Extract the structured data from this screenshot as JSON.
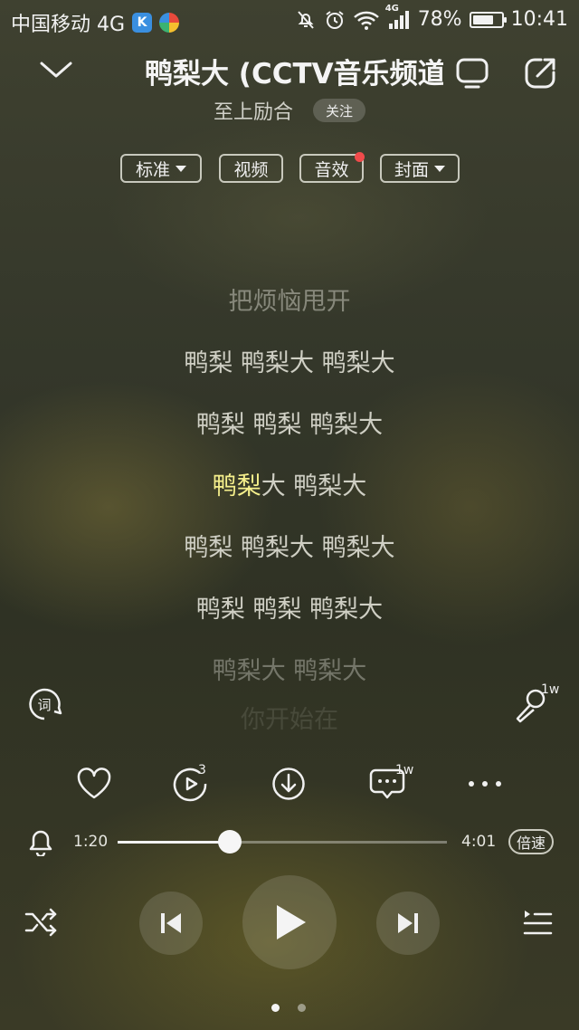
{
  "status_bar": {
    "carrier": "中国移动 4G",
    "network_badge": "4G",
    "battery": "78%",
    "battery_level": 0.78,
    "time": "10:41",
    "icons": [
      "k-app-icon",
      "round-app-icon",
      "mute-icon",
      "alarm-icon",
      "wifi-icon",
      "signal-icon",
      "battery-icon"
    ]
  },
  "header": {
    "song_title": "鸭梨大 (CCTV音乐频道",
    "artist": "至上励合",
    "follow_label": "关注",
    "icons": [
      "chevron-down-icon",
      "tv-cast-icon",
      "share-icon"
    ]
  },
  "chips": {
    "quality": "标准",
    "video": "视频",
    "effects": "音效",
    "cover": "封面"
  },
  "lyrics": {
    "line1": "把烦恼甩开",
    "line2": "鸭梨 鸭梨大 鸭梨大",
    "line3": "鸭梨 鸭梨 鸭梨大",
    "line4_sung": "鸭梨",
    "line4_rest": "大 鸭梨大",
    "line5": "鸭梨 鸭梨大 鸭梨大",
    "line6": "鸭梨 鸭梨 鸭梨大",
    "line7": "鸭梨大 鸭梨大",
    "line8": "你开始在"
  },
  "side": {
    "karaoke_count": "1w"
  },
  "actions": {
    "mv_count": "3",
    "comment_count": "1w",
    "icons": [
      "heart-icon",
      "mv-play-icon",
      "download-icon",
      "comment-icon",
      "more-icon"
    ]
  },
  "progress": {
    "elapsed": "1:20",
    "total": "4:01",
    "fraction": 0.34,
    "speed_label": "倍速"
  },
  "controls": {
    "icons": [
      "shuffle-icon",
      "previous-icon",
      "play-icon",
      "next-icon",
      "playlist-icon"
    ]
  },
  "pager": {
    "pages": 2,
    "active": 0
  },
  "colors": {
    "lyric_highlight": "#f6f08c",
    "dot_red": "#f04b4b"
  }
}
